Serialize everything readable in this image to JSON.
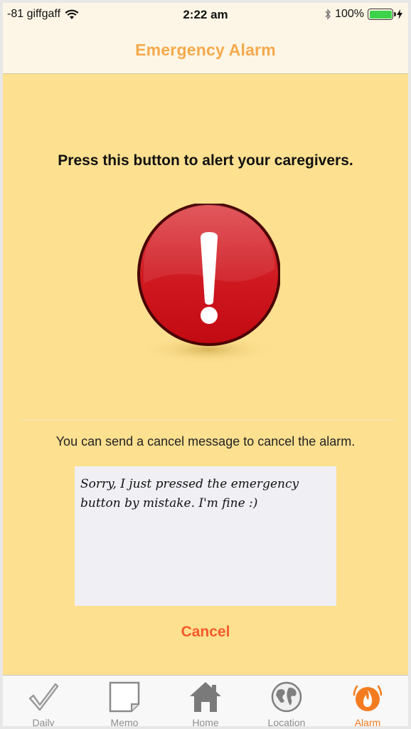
{
  "status_bar": {
    "carrier": "-81 giffgaff",
    "time": "2:22 am",
    "battery": "100%",
    "battery_level": 1.0
  },
  "nav": {
    "title": "Emergency Alarm"
  },
  "main": {
    "prompt": "Press this button to alert your caregivers.",
    "cancel_hint": "You can send a cancel message to cancel the alarm.",
    "message": "Sorry, I just pressed the emergency button by mistake. I'm fine :)",
    "cancel_label": "Cancel"
  },
  "tabs": [
    {
      "label": "Daily",
      "icon": "checkmark-icon"
    },
    {
      "label": "Memo",
      "icon": "note-icon"
    },
    {
      "label": "Home",
      "icon": "house-icon"
    },
    {
      "label": "Location",
      "icon": "globe-icon"
    },
    {
      "label": "Alarm",
      "icon": "alarm-flame-icon",
      "active": true
    }
  ],
  "colors": {
    "background": "#fde090",
    "accent": "#f6a94c",
    "cancel": "#f45b2c",
    "alarm_red": "#cc0d15",
    "active_tab": "#f47c20"
  }
}
